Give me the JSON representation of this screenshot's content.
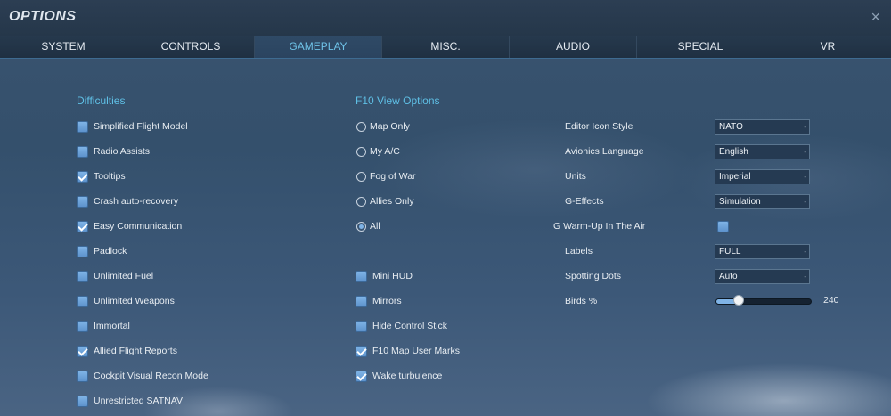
{
  "window": {
    "title": "OPTIONS",
    "close_glyph": "×"
  },
  "tabs": [
    {
      "label": "SYSTEM",
      "active": false
    },
    {
      "label": "CONTROLS",
      "active": false
    },
    {
      "label": "GAMEPLAY",
      "active": true
    },
    {
      "label": "MISC.",
      "active": false
    },
    {
      "label": "AUDIO",
      "active": false
    },
    {
      "label": "SPECIAL",
      "active": false
    },
    {
      "label": "VR",
      "active": false
    }
  ],
  "difficulties": {
    "title": "Difficulties",
    "items": [
      {
        "label": "Simplified Flight Model",
        "checked": false
      },
      {
        "label": "Radio Assists",
        "checked": false
      },
      {
        "label": "Tooltips",
        "checked": true
      },
      {
        "label": "Crash auto-recovery",
        "checked": false
      },
      {
        "label": "Easy Communication",
        "checked": true
      },
      {
        "label": "Padlock",
        "checked": false
      },
      {
        "label": "Unlimited Fuel",
        "checked": false
      },
      {
        "label": "Unlimited Weapons",
        "checked": false
      },
      {
        "label": "Immortal",
        "checked": false
      },
      {
        "label": "Allied Flight Reports",
        "checked": true
      },
      {
        "label": "Cockpit Visual Recon Mode",
        "checked": false
      },
      {
        "label": "Unrestricted SATNAV",
        "checked": false
      }
    ]
  },
  "f10": {
    "title": "F10 View Options",
    "radios": [
      {
        "label": "Map Only",
        "selected": false
      },
      {
        "label": "My A/C",
        "selected": false
      },
      {
        "label": "Fog of War",
        "selected": false
      },
      {
        "label": "Allies Only",
        "selected": false
      },
      {
        "label": "All",
        "selected": true
      }
    ],
    "checks": [
      {
        "label": "Mini HUD",
        "checked": false
      },
      {
        "label": "Mirrors",
        "checked": false
      },
      {
        "label": "Hide Control Stick",
        "checked": false
      },
      {
        "label": "F10 Map User Marks",
        "checked": true
      },
      {
        "label": "Wake turbulence",
        "checked": true
      }
    ]
  },
  "settings": {
    "editor_icon_style": {
      "label": "Editor Icon Style",
      "value": "NATO"
    },
    "avionics_language": {
      "label": "Avionics Language",
      "value": "English"
    },
    "units": {
      "label": "Units",
      "value": "Imperial"
    },
    "g_effects": {
      "label": "G-Effects",
      "value": "Simulation"
    },
    "g_warmup": {
      "label": "G Warm-Up In The Air",
      "checked": false
    },
    "labels": {
      "label": "Labels",
      "value": "FULL"
    },
    "spotting_dots": {
      "label": "Spotting Dots",
      "value": "Auto"
    },
    "birds": {
      "label": "Birds %",
      "value": "240",
      "fraction": 0.24
    }
  },
  "dropdown_glyph": "-"
}
